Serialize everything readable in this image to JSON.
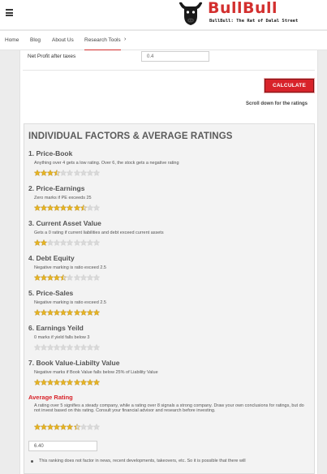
{
  "header": {
    "menu_icon": "hamburger-icon",
    "logo_text": "BullBull",
    "logo_tagline": "BullBull: The Rat of Dalal Street"
  },
  "nav": {
    "items": [
      "Home",
      "Blog",
      "About Us",
      "Research Tools"
    ],
    "active": "Research Tools",
    "caret_icon": "chevron-right-icon"
  },
  "form": {
    "net_profit_label": "Net Profit after taxes",
    "net_profit_value": "0.4"
  },
  "calculate_label": "CALCULATE",
  "scroll_note": "Scroll down for the ratings",
  "ratings": {
    "title": "INDIVIDUAL FACTORS & AVERAGE RATINGS",
    "factors": [
      {
        "title": "1. Price-Book",
        "desc": "Anything over 4 gets a low rating. Over 6, the stock gets a negative rating",
        "stars": 3.5
      },
      {
        "title": "2. Price-Earnings",
        "desc": "Zero marks if PE exceeds 25",
        "stars": 7.5
      },
      {
        "title": "3. Current Asset Value",
        "desc": "Gets a 0 rating if current liabilities and debt exceed current assets",
        "stars": 2
      },
      {
        "title": "4. Debt Equity",
        "desc": "Negative marking is ratio exceed 2.5",
        "stars": 4.5
      },
      {
        "title": "5. Price-Sales",
        "desc": "Negative marking is ratio exceed 2.5",
        "stars": 10
      },
      {
        "title": "6. Earnings Yeild",
        "desc": "0 marks if yield falls below 3",
        "stars": 0
      },
      {
        "title": "7. Book Value-Liabilty Value",
        "desc": "Negative marks if Book Value falls below 25% of Liability Value",
        "stars": 10
      }
    ],
    "average": {
      "title": "Average Rating",
      "desc": "A rating over 5 signifies a steady company, while a rating over 8 signals a strong company. Draw your own conclusions for ratings, but do not invest based on this rating. Consult your financial advisor and research before investing.",
      "stars": 6.4,
      "value": "6.40"
    },
    "note": "This ranking does not factor in news, recent developments, takeovers, etc. So it is possible that there will",
    "star_count": 10
  },
  "colors": {
    "brand_red": "#d8232a",
    "star_fill": "#e6b422",
    "star_empty": "#d9d9d9"
  }
}
